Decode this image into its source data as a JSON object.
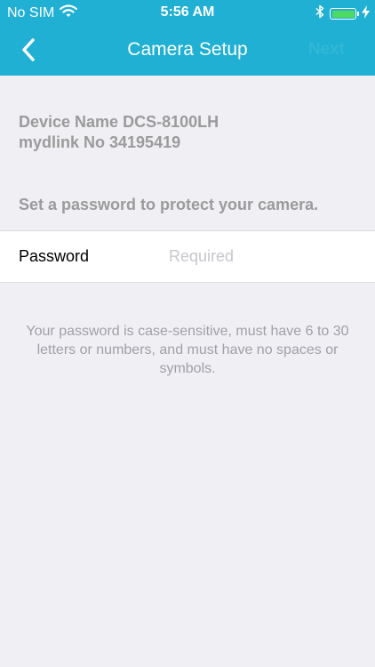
{
  "status_bar": {
    "carrier": "No SIM",
    "time": "5:56 AM",
    "wifi_icon": "wifi-icon",
    "bluetooth_icon": "bluetooth-icon",
    "battery_icon": "battery-icon",
    "charging_icon": "charging-bolt-icon"
  },
  "nav": {
    "title": "Camera Setup",
    "back_icon": "chevron-left-icon",
    "next_label": "Next"
  },
  "device": {
    "name_line": "Device Name DCS-8100LH",
    "mydlink_line": "mydlink No 34195419"
  },
  "instruction": "Set a password to protect your camera.",
  "password": {
    "label": "Password",
    "placeholder": "Required",
    "value": ""
  },
  "hint": "Your password is case-sensitive, must have 6 to 30 letters or numbers, and must have no spaces or symbols.",
  "colors": {
    "accent": "#1fb0d3",
    "background": "#efeff4",
    "battery_fill": "#4cd964",
    "muted_text": "#9b9b9b"
  }
}
